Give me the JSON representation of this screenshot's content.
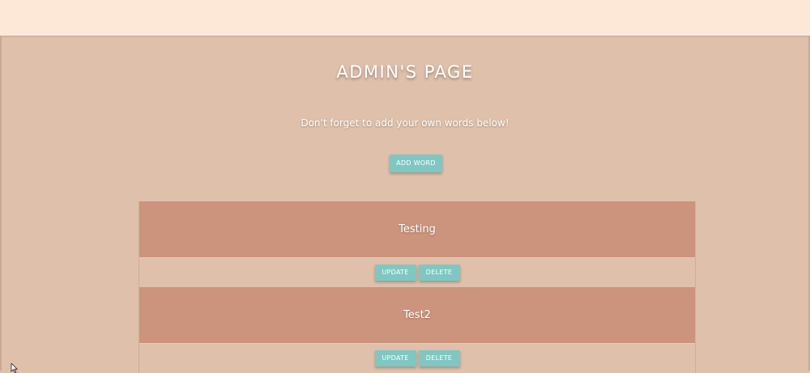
{
  "header": {
    "title": "ADMIN'S PAGE",
    "subtitle": "Don't forget to add your own words below!"
  },
  "actions": {
    "add_word_label": "ADD WORD"
  },
  "words": [
    {
      "name": "Testing",
      "update_label": "UPDATE",
      "delete_label": "DELETE"
    },
    {
      "name": "Test2",
      "update_label": "UPDATE",
      "delete_label": "DELETE"
    }
  ],
  "colors": {
    "background": "#dec0ab",
    "topbar": "#fde8d8",
    "card": "#cc937d",
    "button": "#7fc7c3",
    "text": "#ffffff"
  },
  "icons": {
    "cursor": "mouse-pointer-icon"
  }
}
